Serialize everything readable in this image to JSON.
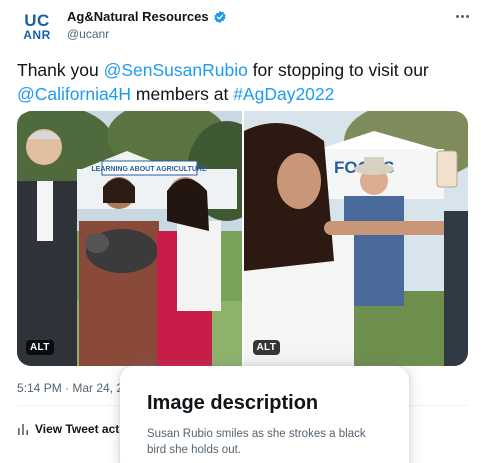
{
  "account": {
    "avatar_line1": "UC",
    "avatar_line2": "ANR",
    "display_name": "Ag&Natural Resources",
    "handle": "@ucanr",
    "verified": true
  },
  "tweet": {
    "text_1": "Thank you ",
    "mention_1": "@SenSusanRubio",
    "text_2": " for stopping to visit our ",
    "mention_2": "@California4H",
    "text_3": " members at ",
    "hashtag": "#AgDay2022"
  },
  "media": {
    "photos": [
      {
        "alt_badge": "ALT",
        "sign_text": "LEARNING ABOUT AGRICULTURE"
      },
      {
        "alt_badge": "ALT",
        "sign_text": "FOODS"
      }
    ]
  },
  "meta": {
    "timestamp": "5:14 PM · Mar 24, 2"
  },
  "actions": {
    "view_activity": "View Tweet activ"
  },
  "image_description_popup": {
    "title": "Image description",
    "body": "Susan Rubio smiles as she strokes a black bird she holds out."
  },
  "colors": {
    "link": "#1d9bf0",
    "text": "#0f1419",
    "secondary": "#536471",
    "brand": "#1a5fa8"
  },
  "icons": [
    "verified-badge-icon",
    "more-options-icon",
    "activity-bars-icon"
  ]
}
